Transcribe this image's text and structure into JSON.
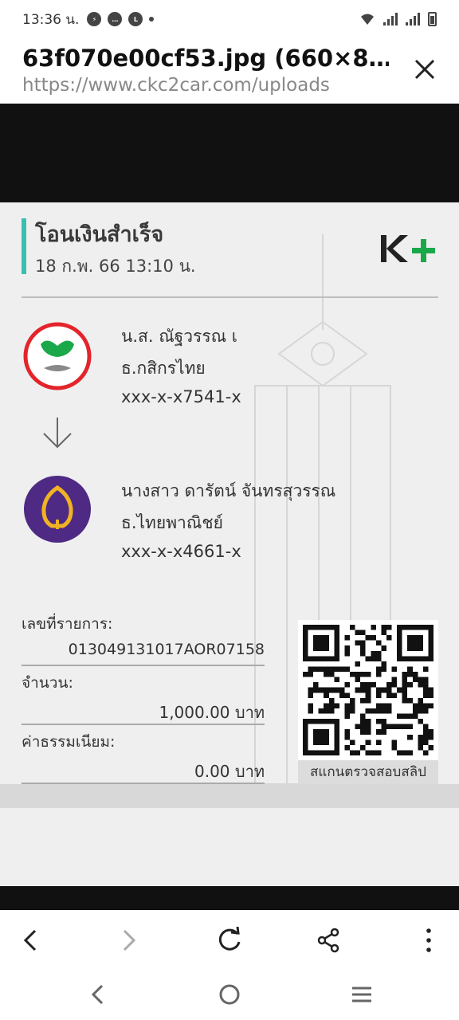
{
  "status_bar": {
    "time": "13:36 น."
  },
  "header": {
    "title": "63f070e00cf53.jpg (660×8…",
    "url": "https://www.ckc2car.com/uploads"
  },
  "slip": {
    "title": "โอนเงินสำเร็จ",
    "datetime": "18 ก.พ. 66  13:10 น.",
    "brand": "K+",
    "sender": {
      "name": "น.ส. ณัฐวรรณ เ",
      "bank": "ธ.กสิกรไทย",
      "account": "xxx-x-x7541-x"
    },
    "receiver": {
      "name": "นางสาว ดารัตน์ จันทรสุวรรณ",
      "bank": "ธ.ไทยพาณิชย์",
      "account": "xxx-x-x4661-x"
    },
    "ref_label": "เลขที่รายการ:",
    "ref_value": "013049131017AOR07158",
    "amount_label": "จำนวน:",
    "amount_value": "1,000.00 บาท",
    "fee_label": "ค่าธรรมเนียม:",
    "fee_value": "0.00 บาท",
    "qr_caption": "สแกนตรวจสอบสลิป"
  },
  "colors": {
    "accent": "#3bbfb0",
    "kbank_green": "#1ba84a",
    "kbank_red": "#e3242b",
    "scb_purple": "#4e2a84",
    "scb_gold": "#f0b323"
  }
}
